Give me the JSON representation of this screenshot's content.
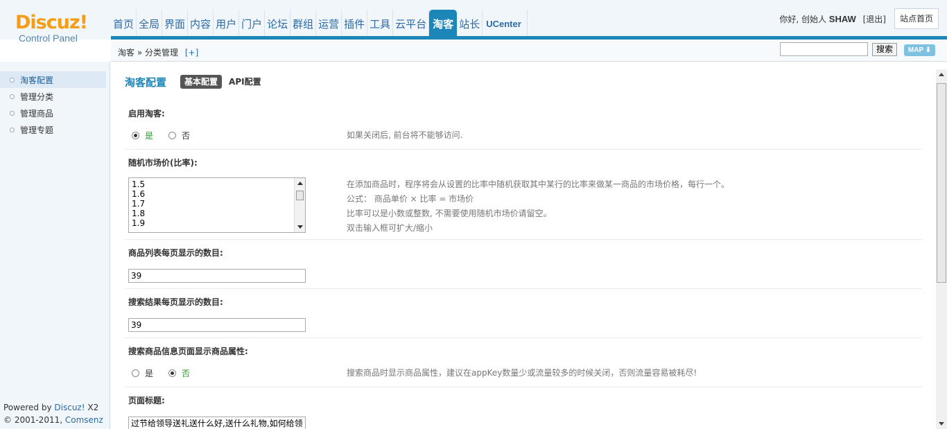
{
  "header": {
    "logo_brand": "Discuz!",
    "logo_sub": "Control Panel",
    "nav": [
      {
        "label": "首页"
      },
      {
        "label": "全局"
      },
      {
        "label": "界面"
      },
      {
        "label": "内容"
      },
      {
        "label": "用户"
      },
      {
        "label": "门户"
      },
      {
        "label": "论坛"
      },
      {
        "label": "群组"
      },
      {
        "label": "运营"
      },
      {
        "label": "插件"
      },
      {
        "label": "工具"
      },
      {
        "label": "云平台"
      },
      {
        "label": "淘客"
      },
      {
        "label": "站长"
      },
      {
        "label": "UCenter"
      }
    ],
    "greeting": "你好, 创始人",
    "username": "SHAW",
    "logout": "[退出]",
    "site_home": "站点首页",
    "accent_color": "#1d86b8"
  },
  "subheader": {
    "breadcrumb_root": "淘客",
    "breadcrumb_sep": "»",
    "breadcrumb_current": "分类管理",
    "breadcrumb_plus": "[+]",
    "search_value": "",
    "search_button": "搜索",
    "map_button": "MAP"
  },
  "sidebar": {
    "items": [
      {
        "label": "淘客配置"
      },
      {
        "label": "管理分类"
      },
      {
        "label": "管理商品"
      },
      {
        "label": "管理专题"
      }
    ],
    "footer_powered": "Powered by",
    "footer_brand": "Discuz!",
    "footer_version": "X2",
    "footer_copy": "© 2001-2011,",
    "footer_company": "Comsenz Inc."
  },
  "main": {
    "title": "淘客配置",
    "tabs": [
      {
        "label": "基本配置"
      },
      {
        "label": "API配置"
      }
    ],
    "sections": {
      "enable": {
        "label": "启用淘客:",
        "yes": "是",
        "no": "否",
        "tip": "如果关闭后, 前台将不能够访问."
      },
      "random_price": {
        "label": "随机市场价(比率):",
        "lines": [
          "1.5",
          "1.6",
          "1.7",
          "1.8",
          "1.9"
        ],
        "tips": [
          "在添加商品时，程序将会从设置的比率中随机获取其中某行的比率来做某一商品的市场价格，每行一个。",
          "公式： 商品单价 × 比率 = 市场价",
          "比率可以是小数或整数, 不需要使用随机市场价请留空。",
          "双击输入框可扩大/缩小"
        ]
      },
      "list_per_page": {
        "label": "商品列表每页显示的数目:",
        "value": "39"
      },
      "search_per_page": {
        "label": "搜索结果每页显示的数目:",
        "value": "39"
      },
      "show_attr": {
        "label": "搜索商品信息页面显示商品属性:",
        "yes": "是",
        "no": "否",
        "tip": "搜索商品时显示商品属性，建议在appKey数量少或流量较多的时候关闭，否则流量容易被耗尽!"
      },
      "page_title": {
        "label": "页面标题:",
        "value": "过节给领导送礼送什么好,送什么礼物,如何给领"
      }
    }
  }
}
